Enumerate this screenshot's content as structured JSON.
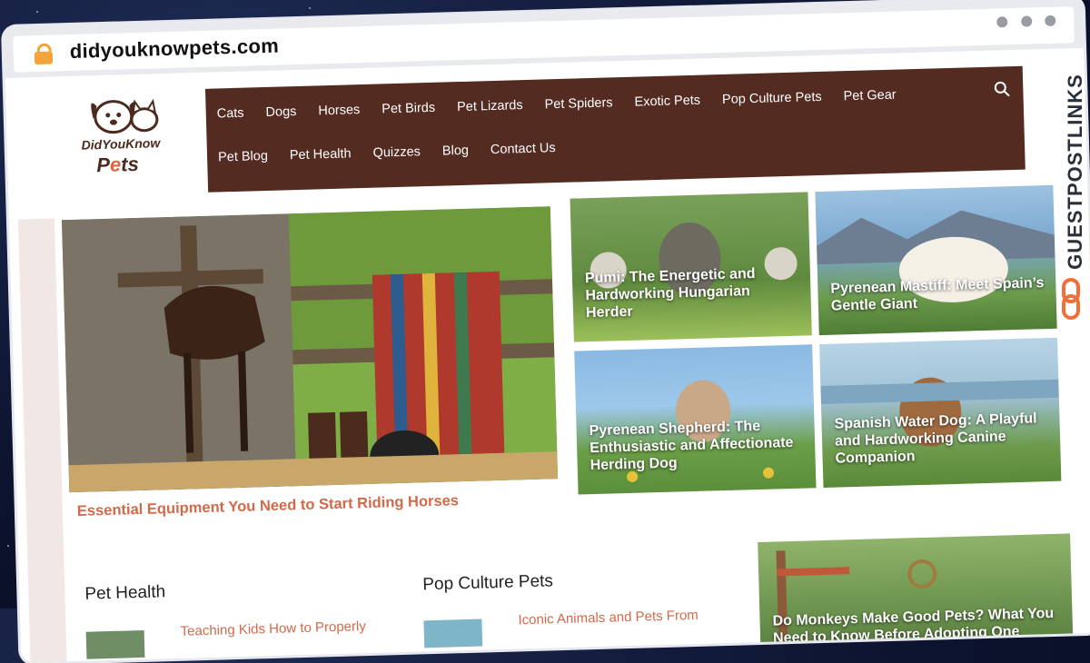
{
  "browser": {
    "url": "didyouknowpets.com"
  },
  "logo": {
    "line1": "DidYouKnow",
    "line2_a": "P",
    "line2_b": "e",
    "line2_c": "ts"
  },
  "nav": {
    "row1": [
      "Cats",
      "Dogs",
      "Horses",
      "Pet Birds",
      "Pet Lizards",
      "Pet Spiders",
      "Exotic Pets",
      "Pop Culture Pets",
      "Pet Gear"
    ],
    "row2": [
      "Pet Blog",
      "Pet Health",
      "Quizzes",
      "Blog",
      "Contact Us"
    ]
  },
  "hero": {
    "caption": "Essential Equipment You Need to Start Riding Horses"
  },
  "cards": [
    {
      "title": "Pumi: The Energetic and Hardworking Hungarian Herder",
      "color": "#6f8a4a"
    },
    {
      "title": "Pyrenean Mastiff: Meet Spain’s Gentle Giant",
      "color": "#5f8ab0"
    },
    {
      "title": "Pyrenean Shepherd: The Enthusiastic and Affectionate Herding Dog",
      "color": "#6aa0cf"
    },
    {
      "title": "Spanish Water Dog: A Playful and Hardworking Canine Companion",
      "color": "#86b4d2"
    }
  ],
  "sections": {
    "pet_health": {
      "heading": "Pet Health",
      "post": "Teaching Kids How to Properly"
    },
    "pop_culture": {
      "heading": "Pop Culture Pets",
      "post": "Iconic Animals and Pets From"
    },
    "feature": {
      "title": "Do Monkeys Make Good Pets? What You Need to Know Before Adopting One"
    }
  },
  "watermark": {
    "text": "GUESTPOSTLINKS"
  },
  "colors": {
    "nav_bg": "#532b21",
    "accent": "#d4684a",
    "brand_orange": "#f0703a"
  }
}
